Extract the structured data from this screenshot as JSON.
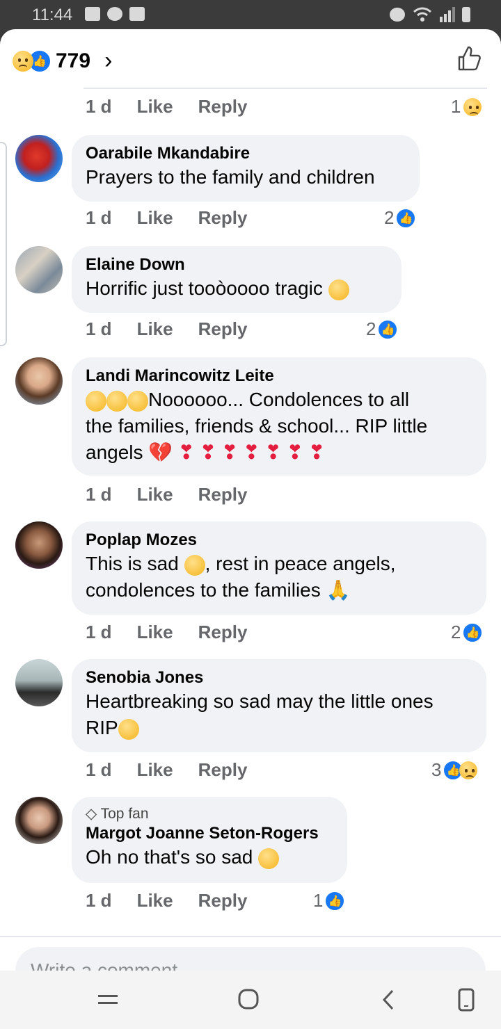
{
  "status": {
    "time": "11:44"
  },
  "header": {
    "reaction_count": "779",
    "chevron": "›"
  },
  "top_meta": {
    "time": "1 d",
    "like": "Like",
    "reply": "Reply",
    "reactions": "1"
  },
  "comments": [
    {
      "author": "Oarabile Mkandabire",
      "text": "Prayers to the family and children",
      "time": "1 d",
      "like": "Like",
      "reply": "Reply",
      "reactions": "2"
    },
    {
      "author": "Elaine Down",
      "text": "Horrific just tooòoooo tragic",
      "time": "1 d",
      "like": "Like",
      "reply": "Reply",
      "reactions": "2"
    },
    {
      "author": "Landi Marincowitz Leite",
      "text_line1": "Noooooo...  Condolences to all",
      "text_line2": "the families, friends &  school...  RIP little",
      "text_line3": "angels",
      "time": "1 d",
      "like": "Like",
      "reply": "Reply"
    },
    {
      "author": "Poplap Mozes",
      "text_line1a": "This is sad",
      "text_line1b": ", rest in peace angels,",
      "text_line2": "condolences to the families",
      "time": "1 d",
      "like": "Like",
      "reply": "Reply",
      "reactions": "2"
    },
    {
      "author": "Senobia Jones",
      "text_line1": "Heartbreaking so sad may the little ones",
      "text_line2": "RIP",
      "time": "1 d",
      "like": "Like",
      "reply": "Reply",
      "reactions": "3"
    },
    {
      "badge": "Top fan",
      "author": "Margot Joanne Seton-Rogers",
      "text": "Oh no that's so sad",
      "time": "1 d",
      "like": "Like",
      "reply": "Reply",
      "reactions": "1"
    }
  ],
  "composer": {
    "placeholder": "Write a comment..."
  },
  "colors": {
    "accent": "#1877f2",
    "bubble": "#f0f2f5",
    "meta": "#65676b",
    "heart": "#e41e3f"
  },
  "icons": [
    "sad-reaction-icon",
    "like-reaction-icon",
    "thumbs-up-icon",
    "chevron-right-icon",
    "diamond-icon",
    "crying-emoji-icon",
    "heart-emoji-icon",
    "praying-hands-icon"
  ]
}
